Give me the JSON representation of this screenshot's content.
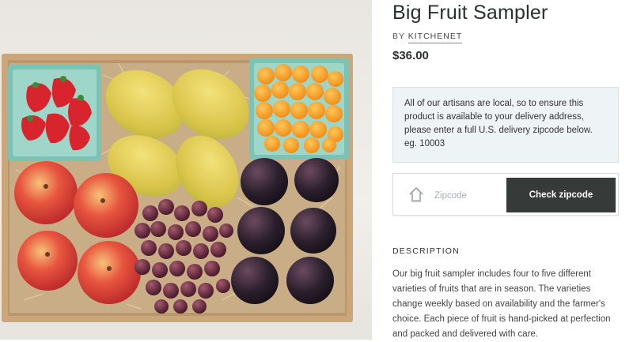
{
  "product": {
    "title": "Big Fruit Sampler",
    "by_prefix": "BY",
    "vendor": "KITCHENET",
    "price": "$36.00",
    "image_alt": "Box of assorted fruits: strawberries, mangoes, apricots, apples, red grapes and plums"
  },
  "notice": {
    "text": "All of our artisans are local, so to ensure this product is available to your delivery address, please enter a full U.S. delivery zipcode below. eg. 10003"
  },
  "zip": {
    "placeholder": "Zipcode",
    "value": "",
    "button_label": "Check zipcode",
    "icon": "home-icon"
  },
  "description": {
    "heading": "DESCRIPTION",
    "body": "Our big fruit sampler includes four to five different varieties of fruits that are in season. The varieties change weekly based on availability and the farmer's choice. Each piece of fruit is hand-picked at perfection and packed and delivered with care."
  },
  "colors": {
    "button_bg": "#363b3a",
    "notice_bg": "#eef3f6",
    "text_dark": "#2b2f2e"
  }
}
